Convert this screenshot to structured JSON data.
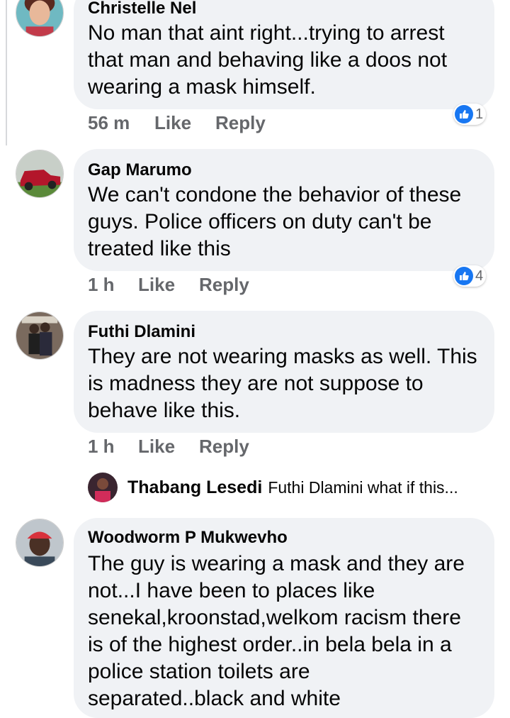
{
  "comments": [
    {
      "author": "Christelle Nel",
      "text": [
        "No man that aint right...trying to arrest",
        "that man and behaving like a doos not",
        "wearing a mask himself."
      ],
      "time": "56 m",
      "like_label": "Like",
      "reply_label": "Reply",
      "reactions": "1",
      "avatar": "woman-avatar"
    },
    {
      "author": "Gap Marumo",
      "text": [
        "We can't condone the behavior of these",
        "guys. Police officers on duty can't be",
        "treated like this"
      ],
      "time": "1 h",
      "like_label": "Like",
      "reply_label": "Reply",
      "reactions": "4",
      "avatar": "red-car-avatar"
    },
    {
      "author": "Futhi Dlamini",
      "text": [
        "They are not wearing masks as well. This",
        "is madness they are not suppose to",
        "behave like this."
      ],
      "time": "1 h",
      "like_label": "Like",
      "reply_label": "Reply",
      "avatar": "couple-avatar"
    },
    {
      "author": "Woodworm P Mukwevho",
      "text": [
        "The guy is wearing a mask and they are",
        "not...I have been to places like",
        "senekal,kroonstad,welkom racism there",
        "is of the highest order..in bela bela in a",
        "police station toilets are",
        "separated..black and white"
      ],
      "avatar": "man-red-cap-avatar"
    }
  ],
  "reply_preview": {
    "author": "Thabang Lesedi",
    "text": "Futhi Dlamini  what if this..."
  },
  "colors": {
    "bubble": "#f0f2f5",
    "meta": "#65676b",
    "like_blue": "#1877f2"
  }
}
